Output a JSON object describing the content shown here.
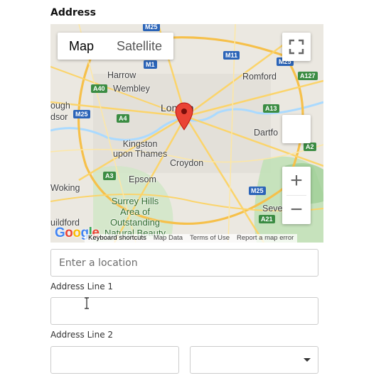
{
  "form": {
    "section_title": "Address",
    "location_input": {
      "placeholder": "Enter a location",
      "value": ""
    },
    "address_line1": {
      "label": "Address Line 1",
      "value": ""
    },
    "address_line2": {
      "label": "Address Line 2",
      "value": ""
    },
    "select": {
      "selected": ""
    }
  },
  "map": {
    "type_buttons": [
      "Map",
      "Satellite"
    ],
    "active_type": "Map",
    "zoom_in": "+",
    "zoom_out": "−",
    "google_logo": "Google",
    "attribution": [
      "Keyboard shortcuts",
      "Map Data",
      "Terms of Use",
      "Report a map error"
    ],
    "places": {
      "harrow": "Harrow",
      "wembley": "Wembley",
      "romford": "Romford",
      "london": "London",
      "slough": "ough",
      "windsor": "dsor",
      "dartford": "Dartfo",
      "kingston": "Kingston\nupon Thames",
      "croydon": "Croydon",
      "woking": "Woking",
      "epsom": "Epsom",
      "surrey_hills": "Surrey Hills\nArea of\nOutstanding\nNatural Beauty",
      "sevenoaks": "Sevenoak",
      "guildford": "uildford"
    },
    "road_shields": {
      "m25_top": "M25",
      "m1": "M1",
      "m11": "M11",
      "m25_ne": "M25",
      "a127": "A127",
      "a40": "A40",
      "a13": "A13",
      "m25_w": "M25",
      "a4": "A4",
      "a2": "A2",
      "a3": "A3",
      "m25_se": "M25",
      "a21": "A21"
    },
    "colors": {
      "pin": "#ea4335",
      "road": "#fbd46b",
      "major_road": "#f6c04a",
      "water": "#aadaff",
      "park": "#c5e3bf",
      "land": "#e9e6df"
    }
  }
}
